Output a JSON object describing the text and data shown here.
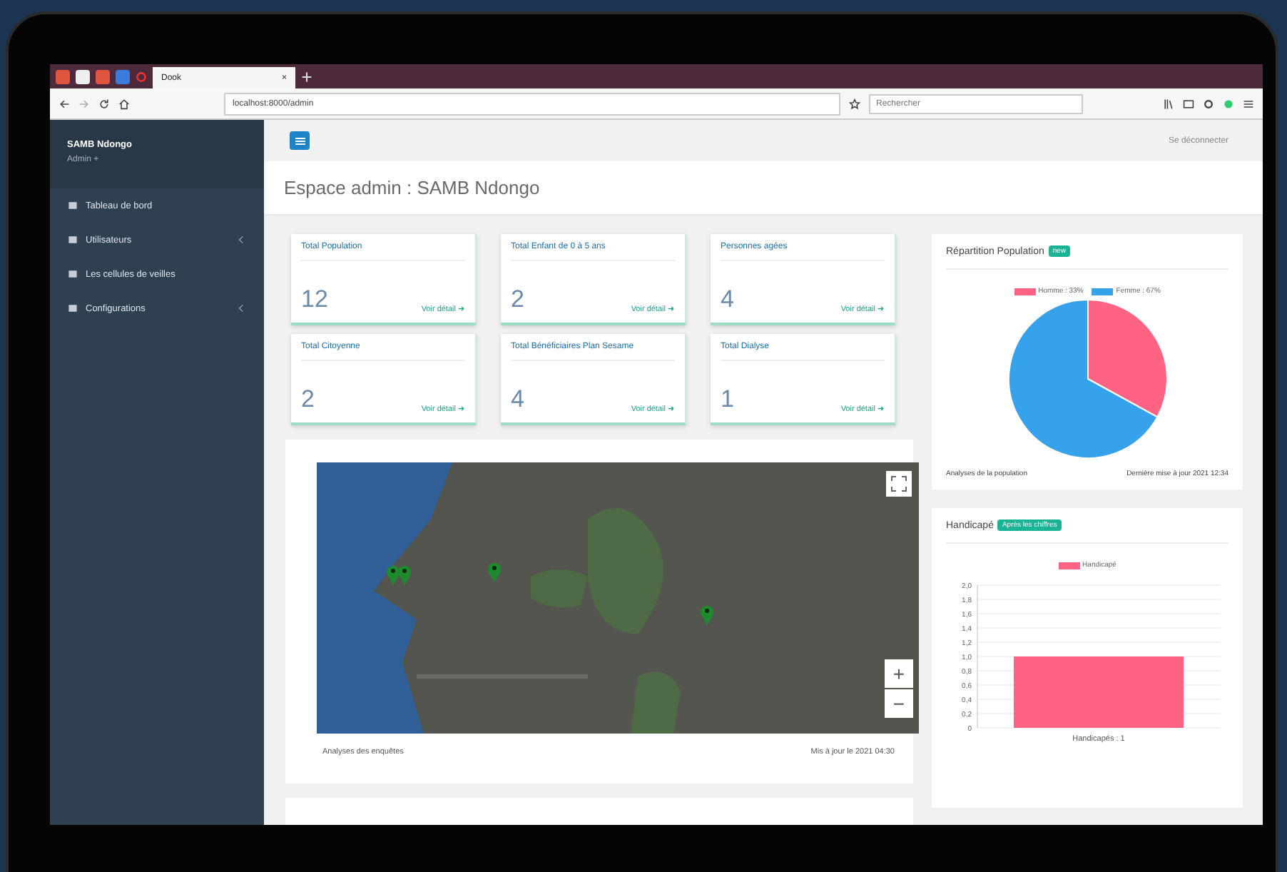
{
  "browser": {
    "tab_title": "Dook",
    "tab_close": "×",
    "address": "localhost:8000/admin",
    "search": {
      "placeholder": "Rechercher"
    }
  },
  "sidebar": {
    "user_name": "SAMB Ndongo",
    "user_role": "Admin +",
    "items": [
      {
        "label": "Tableau de bord",
        "expandable": false
      },
      {
        "label": "Utilisateurs",
        "expandable": true
      },
      {
        "label": "Les cellules de veilles",
        "expandable": false
      },
      {
        "label": "Configurations",
        "expandable": true
      }
    ]
  },
  "header": {
    "logout": "Se déconnecter",
    "page_title": "Espace admin : SAMB Ndongo"
  },
  "stat_cards": [
    {
      "title": "Total Population",
      "value": "12",
      "link": "Voir détail ➜"
    },
    {
      "title": "Total Enfant de 0 à 5 ans",
      "value": "2",
      "link": "Voir détail ➜"
    },
    {
      "title": "Personnes agées",
      "value": "4",
      "link": "Voir détail ➜"
    },
    {
      "title": "Total Citoyenne",
      "value": "2",
      "link": "Voir détail ➜"
    },
    {
      "title": "Total Bénéficiaires Plan Sesame",
      "value": "4",
      "link": "Voir détail ➜"
    },
    {
      "title": "Total Dialyse",
      "value": "1",
      "link": "Voir détail ➜"
    }
  ],
  "map_card": {
    "zoom_in": "+",
    "zoom_out": "−",
    "footer_left": "Analyses des enquêtes",
    "footer_right": "Mis à jour le 2021 04:30"
  },
  "population_card": {
    "title": "Répartition Population",
    "badge": "new",
    "footer_left": "Analyses de la population",
    "footer_right": "Dernière mise à jour 2021 12:34",
    "chart_data": {
      "type": "pie",
      "legend": "top",
      "categories": [
        "Homme : 33%",
        "Femme : 67%"
      ],
      "values": [
        33,
        67
      ],
      "colors": [
        "#ff6384",
        "#36a2eb"
      ]
    }
  },
  "handicap_card": {
    "title": "Handicapé",
    "badge": "Après les chiffres",
    "chart_data": {
      "type": "bar",
      "legend": "top",
      "grid": true,
      "categories": [
        "Handicapés : 1"
      ],
      "series": [
        {
          "name": "Handicapé",
          "color": "#ff6384",
          "values": [
            1
          ]
        }
      ],
      "ylim": [
        0,
        2
      ],
      "yticks": [
        0,
        {
          "value": 0.2,
          "label": "0,2"
        },
        {
          "value": 0.4,
          "label": "0,4"
        },
        {
          "value": 0.6,
          "label": "0,6"
        },
        {
          "value": 0.8,
          "label": "0,8"
        },
        {
          "value": 1,
          "label": "1,0"
        },
        {
          "value": 1.2,
          "label": "1,2"
        },
        {
          "value": 1.4,
          "label": "1,4"
        },
        {
          "value": 1.6,
          "label": "1,6"
        },
        {
          "value": 1.8,
          "label": "1,8"
        },
        {
          "value": 2,
          "label": "2,0"
        }
      ]
    }
  }
}
